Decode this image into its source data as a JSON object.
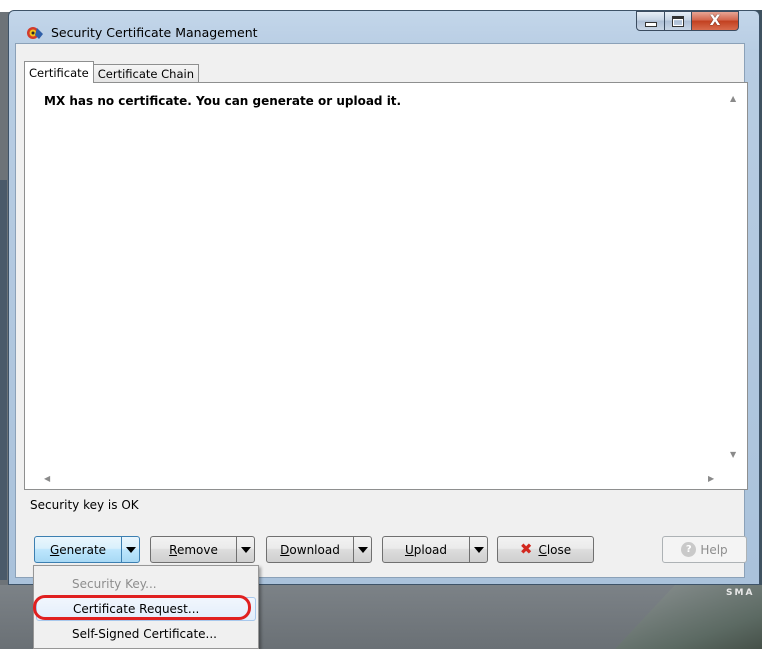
{
  "window": {
    "title": "Security Certificate Management",
    "close_glyph": "X"
  },
  "tabs": [
    {
      "label": "Certificate",
      "active": true
    },
    {
      "label": "Certificate Chain",
      "active": false
    }
  ],
  "content": {
    "message": "MX has no certificate. You can generate or upload it."
  },
  "status": {
    "text": "Security key is OK"
  },
  "buttons": {
    "generate": "Generate",
    "remove": "Remove",
    "download": "Download",
    "upload": "Upload",
    "close": "Close",
    "help": "Help"
  },
  "generate_menu": {
    "items": [
      {
        "label": "Security Key...",
        "enabled": false
      },
      {
        "label": "Certificate Request...",
        "enabled": true,
        "highlighted": true
      },
      {
        "label": "Self-Signed Certificate...",
        "enabled": true
      }
    ]
  },
  "desktop": {
    "brand_text": "SMA"
  },
  "colors": {
    "highlight_ring": "#e02020",
    "close_icon": "#d2281f"
  }
}
